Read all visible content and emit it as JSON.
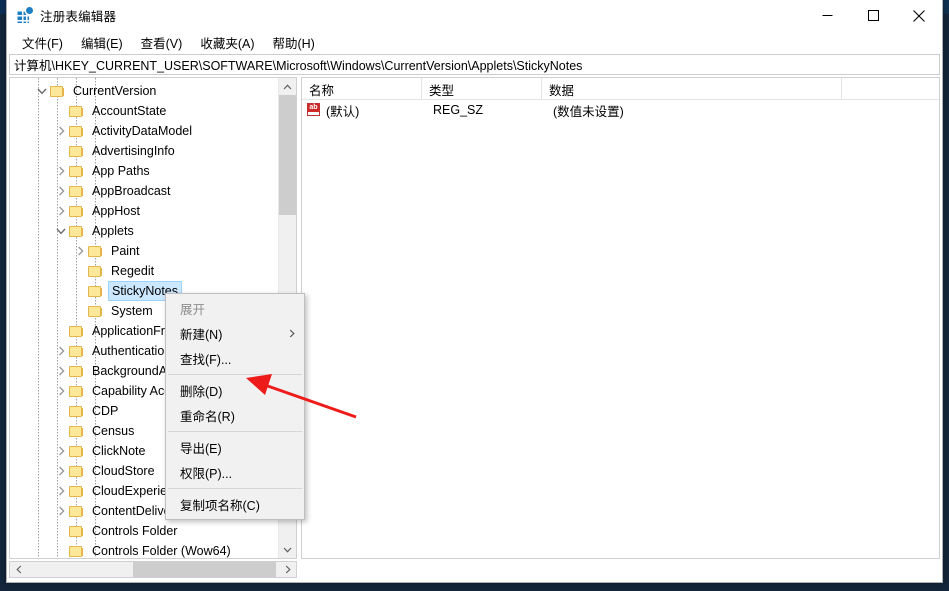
{
  "window": {
    "title": "注册表编辑器",
    "icon": "registry-editor-icon",
    "buttons": {
      "minimize": "minimize-icon",
      "maximize": "maximize-icon",
      "close": "close-icon"
    }
  },
  "menubar": {
    "items": [
      {
        "label": "文件(F)",
        "name": "menu-file"
      },
      {
        "label": "编辑(E)",
        "name": "menu-edit"
      },
      {
        "label": "查看(V)",
        "name": "menu-view"
      },
      {
        "label": "收藏夹(A)",
        "name": "menu-favorites"
      },
      {
        "label": "帮助(H)",
        "name": "menu-help"
      }
    ]
  },
  "addressbar": {
    "path": "计算机\\HKEY_CURRENT_USER\\SOFTWARE\\Microsoft\\Windows\\CurrentVersion\\Applets\\StickyNotes"
  },
  "tree": {
    "nodes": [
      {
        "label": "CurrentVersion",
        "indent": 1,
        "twisty": "expanded",
        "selected": false
      },
      {
        "label": "AccountState",
        "indent": 2,
        "twisty": "none",
        "selected": false
      },
      {
        "label": "ActivityDataModel",
        "indent": 2,
        "twisty": "collapsed",
        "selected": false
      },
      {
        "label": "AdvertisingInfo",
        "indent": 2,
        "twisty": "none",
        "selected": false
      },
      {
        "label": "App Paths",
        "indent": 2,
        "twisty": "collapsed",
        "selected": false
      },
      {
        "label": "AppBroadcast",
        "indent": 2,
        "twisty": "collapsed",
        "selected": false
      },
      {
        "label": "AppHost",
        "indent": 2,
        "twisty": "collapsed",
        "selected": false
      },
      {
        "label": "Applets",
        "indent": 2,
        "twisty": "expanded",
        "selected": false
      },
      {
        "label": "Paint",
        "indent": 3,
        "twisty": "collapsed",
        "selected": false
      },
      {
        "label": "Regedit",
        "indent": 3,
        "twisty": "none",
        "selected": false
      },
      {
        "label": "StickyNotes",
        "indent": 3,
        "twisty": "none",
        "selected": true
      },
      {
        "label": "System",
        "indent": 3,
        "twisty": "none",
        "selected": false
      },
      {
        "label": "ApplicationFrame",
        "indent": 2,
        "twisty": "none",
        "selected": false
      },
      {
        "label": "Authentication",
        "indent": 2,
        "twisty": "collapsed",
        "selected": false
      },
      {
        "label": "BackgroundAccessApplications",
        "indent": 2,
        "twisty": "collapsed",
        "selected": false
      },
      {
        "label": "Capability Access Manager",
        "indent": 2,
        "twisty": "collapsed",
        "selected": false
      },
      {
        "label": "CDP",
        "indent": 2,
        "twisty": "none",
        "selected": false
      },
      {
        "label": "Census",
        "indent": 2,
        "twisty": "none",
        "selected": false
      },
      {
        "label": "ClickNote",
        "indent": 2,
        "twisty": "collapsed",
        "selected": false
      },
      {
        "label": "CloudStore",
        "indent": 2,
        "twisty": "collapsed",
        "selected": false
      },
      {
        "label": "CloudExperienceHost",
        "indent": 2,
        "twisty": "collapsed",
        "selected": false
      },
      {
        "label": "ContentDeliveryManager",
        "indent": 2,
        "twisty": "collapsed",
        "selected": false
      },
      {
        "label": "Controls Folder",
        "indent": 2,
        "twisty": "none",
        "selected": false
      },
      {
        "label": "Controls Folder (Wow64)",
        "indent": 2,
        "twisty": "none",
        "selected": false
      }
    ]
  },
  "list": {
    "columns": [
      "名称",
      "类型",
      "数据"
    ],
    "rows": [
      {
        "name": "(默认)",
        "type": "REG_SZ",
        "data": "(数值未设置)",
        "icon": "string-value-icon"
      }
    ]
  },
  "contextmenu": {
    "items": [
      {
        "label": "展开",
        "name": "ctx-expand",
        "disabled": true,
        "submenu": false
      },
      {
        "label": "新建(N)",
        "name": "ctx-new",
        "disabled": false,
        "submenu": true
      },
      {
        "label": "查找(F)...",
        "name": "ctx-find",
        "disabled": false,
        "submenu": false
      },
      {
        "sep": true
      },
      {
        "label": "删除(D)",
        "name": "ctx-delete",
        "disabled": false,
        "submenu": false
      },
      {
        "label": "重命名(R)",
        "name": "ctx-rename",
        "disabled": false,
        "submenu": false
      },
      {
        "sep": true
      },
      {
        "label": "导出(E)",
        "name": "ctx-export",
        "disabled": false,
        "submenu": false
      },
      {
        "label": "权限(P)...",
        "name": "ctx-permissions",
        "disabled": false,
        "submenu": false
      },
      {
        "sep": true
      },
      {
        "label": "复制项名称(C)",
        "name": "ctx-copy-key-name",
        "disabled": false,
        "submenu": false
      }
    ]
  },
  "annotation": {
    "arrow_color": "#ee1b1b",
    "points_to": "ctx-delete"
  },
  "colors": {
    "selection": "#cce8ff",
    "folder": "#fde89a",
    "accent": "#1d7fc4"
  }
}
